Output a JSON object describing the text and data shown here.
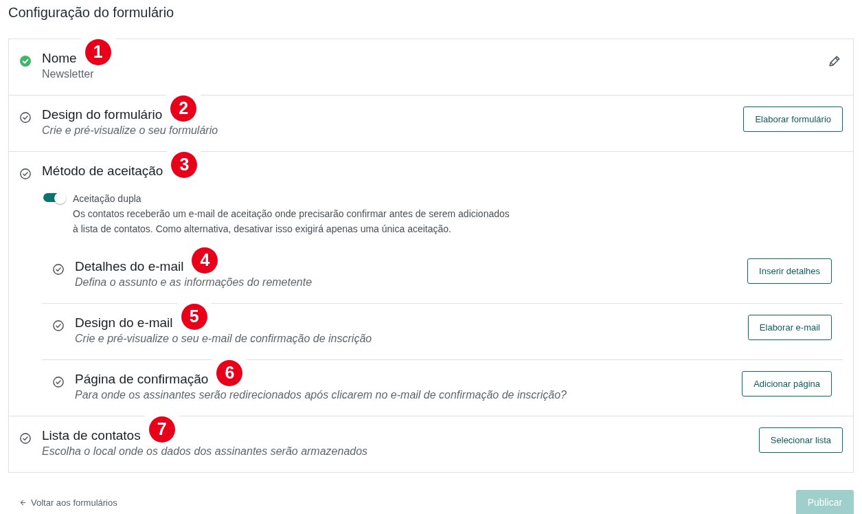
{
  "page_title": "Configuração do formulário",
  "steps": [
    {
      "kind": "field",
      "badge": "1",
      "title": "Nome",
      "value": "Newsletter",
      "complete": true
    },
    {
      "kind": "action",
      "badge": "2",
      "title": "Design do formulário",
      "subtitle": "Crie e pré-visualize o seu formulário",
      "complete": false,
      "button": "Elaborar formulário"
    },
    {
      "kind": "group",
      "badge": "3",
      "title": "Método de aceitação",
      "complete": false,
      "toggle": {
        "label": "Aceitação dupla",
        "on": true,
        "description": "Os contatos receberão um e-mail de aceitação onde precisarão confirmar antes de serem adicionados à lista de contatos. Como alternativa, desativar isso exigirá apenas uma única aceitação."
      },
      "children": [
        {
          "kind": "action",
          "badge": "4",
          "title": "Detalhes do e-mail",
          "subtitle": "Defina o assunto e as informações do remetente",
          "complete": false,
          "button": "Inserir detalhes"
        },
        {
          "kind": "action",
          "badge": "5",
          "title": "Design do e-mail",
          "subtitle": "Crie e pré-visualize o seu e-mail de confirmação de inscrição",
          "complete": false,
          "button": "Elaborar e-mail"
        },
        {
          "kind": "action",
          "badge": "6",
          "title": "Página de confirmação",
          "subtitle": "Para onde os assinantes serão redirecionados após clicarem no e-mail de confirmação de inscrição?",
          "complete": false,
          "button": "Adicionar página"
        }
      ]
    },
    {
      "kind": "action",
      "badge": "7",
      "title": "Lista de contatos",
      "subtitle": "Escolha o local onde os dados dos assinantes serão armazenados",
      "complete": false,
      "button": "Selecionar lista"
    }
  ],
  "footer": {
    "back_link": "Voltar aos formulários",
    "publish_button": {
      "label": "Publicar",
      "disabled": true
    }
  }
}
